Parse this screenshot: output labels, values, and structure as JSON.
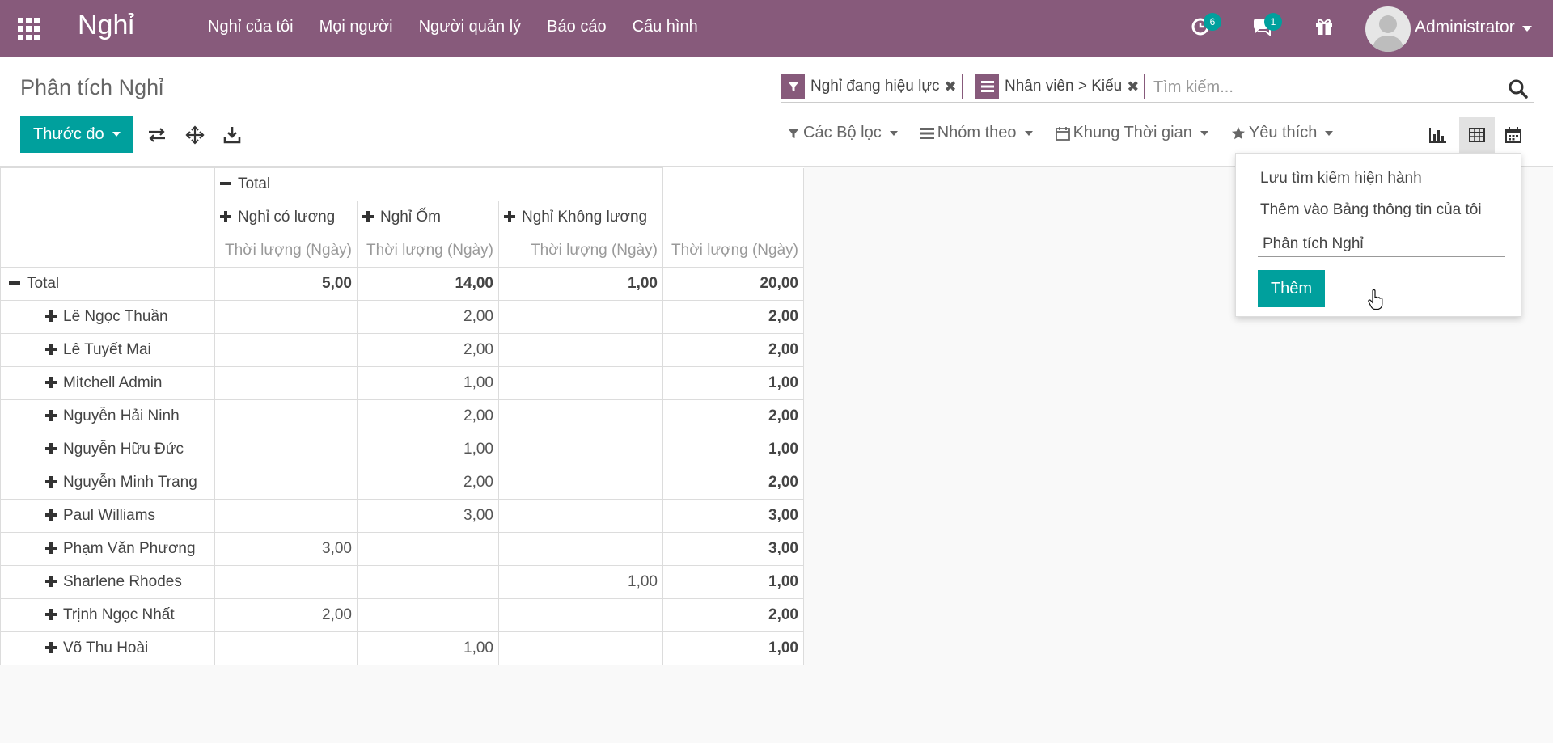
{
  "app": {
    "brand": "Nghỉ"
  },
  "menu": [
    "Nghỉ của tôi",
    "Mọi người",
    "Người quản lý",
    "Báo cáo",
    "Cấu hình"
  ],
  "systray": {
    "activity_count": "6",
    "message_count": "1",
    "user_name": "Administrator"
  },
  "control": {
    "title": "Phân tích Nghỉ",
    "facets": [
      "Nghỉ đang hiệu lực",
      "Nhân viên > Kiểu"
    ],
    "search_placeholder": "Tìm kiếm...",
    "measure_label": "Thước đo",
    "filters_label": "Các Bộ lọc",
    "groupby_label": "Nhóm theo",
    "timeframe_label": "Khung Thời gian",
    "favorites_label": "Yêu thích"
  },
  "favorites_menu": {
    "save_current": "Lưu tìm kiếm hiện hành",
    "add_dashboard": "Thêm vào Bảng thông tin của tôi",
    "dashboard_name": "Phân tích Nghỉ",
    "add_button": "Thêm"
  },
  "pivot": {
    "col_total": "Total",
    "columns": [
      "Nghỉ có lương",
      "Nghỉ Ốm",
      "Nghỉ Không lương"
    ],
    "measure": "Thời lượng (Ngày)",
    "total_row": {
      "label": "Total",
      "values": [
        "5,00",
        "14,00",
        "1,00",
        "20,00"
      ]
    },
    "rows": [
      {
        "name": "Lê Ngọc Thuần",
        "values": [
          "",
          "2,00",
          "",
          "2,00"
        ]
      },
      {
        "name": "Lê Tuyết Mai",
        "values": [
          "",
          "2,00",
          "",
          "2,00"
        ]
      },
      {
        "name": "Mitchell Admin",
        "values": [
          "",
          "1,00",
          "",
          "1,00"
        ]
      },
      {
        "name": "Nguyễn Hải Ninh",
        "values": [
          "",
          "2,00",
          "",
          "2,00"
        ]
      },
      {
        "name": "Nguyễn Hữu Đức",
        "values": [
          "",
          "1,00",
          "",
          "1,00"
        ]
      },
      {
        "name": "Nguyễn Minh Trang",
        "values": [
          "",
          "2,00",
          "",
          "2,00"
        ]
      },
      {
        "name": "Paul Williams",
        "values": [
          "",
          "3,00",
          "",
          "3,00"
        ]
      },
      {
        "name": "Phạm Văn Phương",
        "values": [
          "3,00",
          "",
          "",
          "3,00"
        ]
      },
      {
        "name": "Sharlene Rhodes",
        "values": [
          "",
          "",
          "1,00",
          "1,00"
        ]
      },
      {
        "name": "Trịnh Ngọc Nhất",
        "values": [
          "2,00",
          "",
          "",
          "2,00"
        ]
      },
      {
        "name": "Võ Thu Hoài",
        "values": [
          "",
          "1,00",
          "",
          "1,00"
        ]
      }
    ]
  }
}
